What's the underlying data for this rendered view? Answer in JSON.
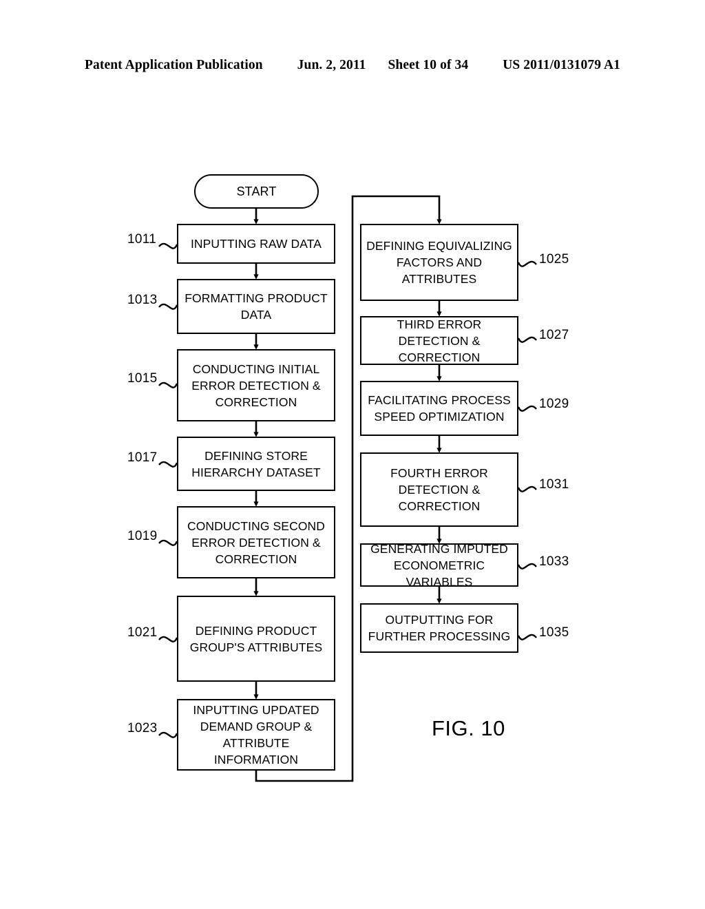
{
  "header": {
    "publication": "Patent Application Publication",
    "date": "Jun. 2, 2011",
    "sheet": "Sheet 10 of 34",
    "patent_number": "US 2011/0131079 A1"
  },
  "figure": {
    "caption": "FIG. 10",
    "start_label": "START"
  },
  "left_column": [
    {
      "ref": "1011",
      "text": "INPUTTING RAW DATA"
    },
    {
      "ref": "1013",
      "text": "FORMATTING PRODUCT DATA"
    },
    {
      "ref": "1015",
      "text": "CONDUCTING INITIAL ERROR DETECTION & CORRECTION"
    },
    {
      "ref": "1017",
      "text": "DEFINING STORE HIERARCHY DATASET"
    },
    {
      "ref": "1019",
      "text": "CONDUCTING SECOND ERROR DETECTION & CORRECTION"
    },
    {
      "ref": "1021",
      "text": "DEFINING PRODUCT GROUP'S ATTRIBUTES"
    },
    {
      "ref": "1023",
      "text": "INPUTTING UPDATED DEMAND GROUP & ATTRIBUTE INFORMATION"
    }
  ],
  "right_column": [
    {
      "ref": "1025",
      "text": "DEFINING EQUIVALIZING FACTORS AND ATTRIBUTES"
    },
    {
      "ref": "1027",
      "text": "THIRD ERROR DETECTION & CORRECTION"
    },
    {
      "ref": "1029",
      "text": "FACILITATING PROCESS SPEED OPTIMIZATION"
    },
    {
      "ref": "1031",
      "text": "FOURTH ERROR DETECTION & CORRECTION"
    },
    {
      "ref": "1033",
      "text": "GENERATING IMPUTED ECONOMETRIC VARIABLES"
    },
    {
      "ref": "1035",
      "text": "OUTPUTTING FOR FURTHER PROCESSING"
    }
  ]
}
